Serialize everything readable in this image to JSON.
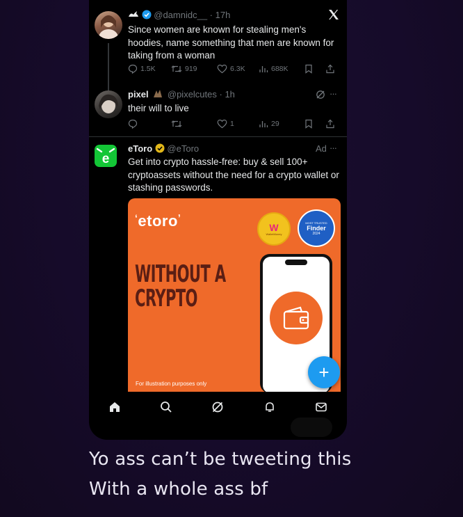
{
  "tweet1": {
    "handle": "@damnidc__",
    "time": "· 17h",
    "text": "Since women are known for stealing men's hoodies, name something that men are known for taking from a woman",
    "replies": "1.5K",
    "reposts": "919",
    "likes": "6.3K",
    "views": "688K"
  },
  "tweet2": {
    "name": "pixel",
    "handle": "@pixelcutes",
    "time": "· 1h",
    "text": "their will to live",
    "replies": "",
    "reposts": "",
    "likes": "1",
    "views": "29"
  },
  "ad": {
    "name": "eToro",
    "handle": "@eToro",
    "badge": "Ad",
    "text": "Get into crypto hassle-free: buy & sell 100+ cryptoassets without the need for a crypto wallet or stashing passwords.",
    "brand": "eToro",
    "headline_line1": "WITHOUT A",
    "headline_line2": "CRYPTO",
    "footnote": "For illustration  purposes only",
    "badge1_text": "WalletMoney",
    "badge2_title": "MOST TRUSTED",
    "badge2_text": "Finder",
    "badge2_year": "2024"
  },
  "caption": {
    "line1": "Yo ass can’t be tweeting this",
    "line2": "With a whole ass bf"
  },
  "colors": {
    "accent": "#1d9bf0",
    "etoro_green": "#13c636",
    "ad_orange": "#ef6a2a"
  },
  "icons": [
    "x-logo-icon",
    "verified-icon",
    "reply-icon",
    "repost-icon",
    "like-icon",
    "views-icon",
    "bookmark-icon",
    "share-icon",
    "grok-icon",
    "more-icon",
    "home-icon",
    "search-icon",
    "grok-nav-icon",
    "notifications-icon",
    "messages-icon",
    "compose-icon"
  ]
}
